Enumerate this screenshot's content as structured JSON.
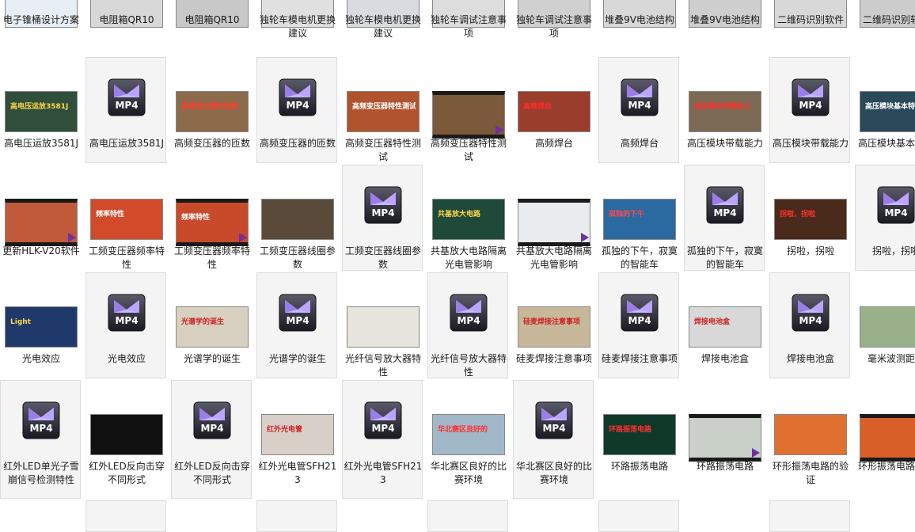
{
  "colors": {
    "selection_bg": "#f4f4f4",
    "selection_border": "#dcdcdc",
    "mp4_accent": "#7a5ccc",
    "film_strip": "#1a1a1a"
  },
  "rows": [
    {
      "items": [
        {
          "label": "电子锥桶设计方案",
          "kind": "thumb",
          "thumb_text": "",
          "bg": "#e8eef5",
          "fg": "#333333",
          "film": false
        },
        {
          "label": "电阻箱QR10",
          "kind": "thumb",
          "thumb_text": "",
          "bg": "#d8d8d8",
          "fg": "#333333",
          "film": false
        },
        {
          "label": "电阻箱QR10",
          "kind": "thumb",
          "thumb_text": "",
          "bg": "#c8c8c8",
          "fg": "#333333",
          "film": false
        },
        {
          "label": "独轮车模电机更换建议",
          "kind": "thumb",
          "thumb_text": "",
          "bg": "#e0e0e0",
          "fg": "#333333",
          "film": false
        },
        {
          "label": "独轮车模电机更换建议",
          "kind": "thumb",
          "thumb_text": "",
          "bg": "#d8dbe0",
          "fg": "#333333",
          "film": false
        },
        {
          "label": "独轮车调试注意事项",
          "kind": "thumb",
          "thumb_text": "",
          "bg": "#dddddd",
          "fg": "#333333",
          "film": false
        },
        {
          "label": "独轮车调试注意事项",
          "kind": "thumb",
          "thumb_text": "",
          "bg": "#d0d0d0",
          "fg": "#333333",
          "film": false
        },
        {
          "label": "堆叠9V电池结构",
          "kind": "thumb",
          "thumb_text": "",
          "bg": "#d8d8d8",
          "fg": "#333333",
          "film": false
        },
        {
          "label": "堆叠9V电池结构",
          "kind": "thumb",
          "thumb_text": "",
          "bg": "#cfcfcf",
          "fg": "#333333",
          "film": false
        },
        {
          "label": "二维码识别软件",
          "kind": "thumb",
          "thumb_text": "",
          "bg": "#d8d8d8",
          "fg": "#333333",
          "film": false
        },
        {
          "label": "二维码识别软件",
          "kind": "thumb",
          "thumb_text": "",
          "bg": "#cccccc",
          "fg": "#333333",
          "film": false
        }
      ]
    },
    {
      "items": [
        {
          "label": "高电压运放3581J",
          "kind": "thumb",
          "thumb_text": "高电压运放3581J",
          "bg": "#2f4f3a",
          "fg": "#ffd54a",
          "film": false
        },
        {
          "label": "高电压运放3581J",
          "kind": "mp4"
        },
        {
          "label": "高频变压器的匝数",
          "kind": "thumb",
          "thumb_text": "高频变压器的匝数",
          "bg": "#8c6b4a",
          "fg": "#ff3b30",
          "film": false
        },
        {
          "label": "高频变压器的匝数",
          "kind": "mp4"
        },
        {
          "label": "高频变压器特性测试",
          "kind": "thumb",
          "thumb_text": "高频变压器特性测试",
          "bg": "#b0542e",
          "fg": "#ffffff",
          "film": false
        },
        {
          "label": "高频变压器特性测试",
          "kind": "thumb",
          "thumb_text": "",
          "bg": "#7a5a3a",
          "fg": "#ffffff",
          "film": true
        },
        {
          "label": "高频焊台",
          "kind": "thumb",
          "thumb_text": "高频焊台",
          "bg": "#9a3d2c",
          "fg": "#ff2d2d",
          "film": false
        },
        {
          "label": "高频焊台",
          "kind": "mp4"
        },
        {
          "label": "高压模块带载能力",
          "kind": "thumb",
          "thumb_text": "高压模块带载能力",
          "bg": "#7c6a55",
          "fg": "#ff3030",
          "film": false
        },
        {
          "label": "高压模块带载能力",
          "kind": "mp4"
        },
        {
          "label": "高压模块基本特性",
          "kind": "thumb",
          "thumb_text": "高压模块基本特性",
          "bg": "#2a4a5a",
          "fg": "#ffffff",
          "film": false
        }
      ]
    },
    {
      "items": [
        {
          "label": "更新HLK-V20软件",
          "kind": "thumb",
          "thumb_text": "",
          "bg": "#c05a3a",
          "fg": "#ffffff",
          "film": true
        },
        {
          "label": "工频变压器频率特性",
          "kind": "thumb",
          "thumb_text": "频率特性",
          "bg": "#d24a2a",
          "fg": "#ffffff",
          "film": false
        },
        {
          "label": "工频变压器频率特性",
          "kind": "thumb",
          "thumb_text": "频率特性",
          "bg": "#c84a2a",
          "fg": "#ffffff",
          "film": true
        },
        {
          "label": "工频变压器线圈参数",
          "kind": "thumb",
          "thumb_text": "",
          "bg": "#5a4a3a",
          "fg": "#ffffff",
          "film": false
        },
        {
          "label": "工频变压器线圈参数",
          "kind": "mp4"
        },
        {
          "label": "共基放大电路隔离光电管影响",
          "kind": "thumb",
          "thumb_text": "共基放大电路",
          "bg": "#1f4a3a",
          "fg": "#ffd54a",
          "film": false
        },
        {
          "label": "共基放大电路隔离光电管影响",
          "kind": "thumb",
          "thumb_text": "",
          "bg": "#e8ecef",
          "fg": "#333333",
          "film": true
        },
        {
          "label": "孤独的下午，寂寞的智能车",
          "kind": "thumb",
          "thumb_text": "孤独的下午",
          "bg": "#2a6aa0",
          "fg": "#ff4a4a",
          "film": false
        },
        {
          "label": "孤独的下午，寂寞的智能车",
          "kind": "mp4"
        },
        {
          "label": "拐啦，拐啦",
          "kind": "thumb",
          "thumb_text": "拐啦，拐啦",
          "bg": "#4a2a1a",
          "fg": "#ff3030",
          "film": false
        },
        {
          "label": "拐啦，拐啦",
          "kind": "mp4"
        }
      ]
    },
    {
      "items": [
        {
          "label": "光电效应",
          "kind": "thumb",
          "thumb_text": "Light",
          "bg": "#1f3a6a",
          "fg": "#ffd54a",
          "film": false
        },
        {
          "label": "光电效应",
          "kind": "mp4"
        },
        {
          "label": "光谱学的诞生",
          "kind": "thumb",
          "thumb_text": "光谱学的诞生",
          "bg": "#d8d0c0",
          "fg": "#cc2222",
          "film": false
        },
        {
          "label": "光谱学的诞生",
          "kind": "mp4"
        },
        {
          "label": "光纤信号放大器特性",
          "kind": "thumb",
          "thumb_text": "",
          "bg": "#e8e4de",
          "fg": "#333333",
          "film": false
        },
        {
          "label": "光纤信号放大器特性",
          "kind": "mp4"
        },
        {
          "label": "硅麦焊接注意事项",
          "kind": "thumb",
          "thumb_text": "硅麦焊接注意事项",
          "bg": "#c8b89a",
          "fg": "#cc2222",
          "film": false
        },
        {
          "label": "硅麦焊接注意事项",
          "kind": "mp4"
        },
        {
          "label": "焊接电池盒",
          "kind": "thumb",
          "thumb_text": "焊接电池盒",
          "bg": "#d8d8d8",
          "fg": "#cc2222",
          "film": false
        },
        {
          "label": "焊接电池盒",
          "kind": "mp4"
        },
        {
          "label": "毫米波测距仪",
          "kind": "thumb",
          "thumb_text": "",
          "bg": "#9ab08a",
          "fg": "#ffffff",
          "film": false
        }
      ]
    },
    {
      "items": [
        {
          "label": "红外LED单光子雪崩信号检测特性",
          "kind": "mp4"
        },
        {
          "label": "红外LED反向击穿不同形式",
          "kind": "thumb",
          "thumb_text": "",
          "bg": "#111111",
          "fg": "#e0e0e0",
          "film": false
        },
        {
          "label": "红外LED反向击穿不同形式",
          "kind": "mp4"
        },
        {
          "label": "红外光电管SFH213",
          "kind": "thumb",
          "thumb_text": "红外光电管",
          "bg": "#d8d0c8",
          "fg": "#cc2222",
          "film": false
        },
        {
          "label": "红外光电管SFH213",
          "kind": "mp4"
        },
        {
          "label": "华北赛区良好的比赛环境",
          "kind": "thumb",
          "thumb_text": "华北赛区良好的",
          "bg": "#a0b8c8",
          "fg": "#ff3030",
          "film": false
        },
        {
          "label": "华北赛区良好的比赛环境",
          "kind": "mp4"
        },
        {
          "label": "环路振荡电路",
          "kind": "thumb",
          "thumb_text": "环路振荡电路",
          "bg": "#0f3a2a",
          "fg": "#ff3030",
          "film": false
        },
        {
          "label": "环路振荡电路",
          "kind": "thumb",
          "thumb_text": "",
          "bg": "#c8d0c8",
          "fg": "#333333",
          "film": true
        },
        {
          "label": "环形振荡电路的验证",
          "kind": "thumb",
          "thumb_text": "",
          "bg": "#e07030",
          "fg": "#ffffff",
          "film": false
        },
        {
          "label": "环形振荡电路验证",
          "kind": "thumb",
          "thumb_text": "",
          "bg": "#d86028",
          "fg": "#ffffff",
          "film": true
        }
      ]
    },
    {
      "items": [
        {
          "label": "",
          "kind": "partial"
        },
        {
          "label": "",
          "kind": "partial"
        },
        {
          "label": "",
          "kind": "partial"
        },
        {
          "label": "",
          "kind": "partial"
        },
        {
          "label": "",
          "kind": "partial"
        }
      ]
    }
  ],
  "mp4_text": "MP4"
}
